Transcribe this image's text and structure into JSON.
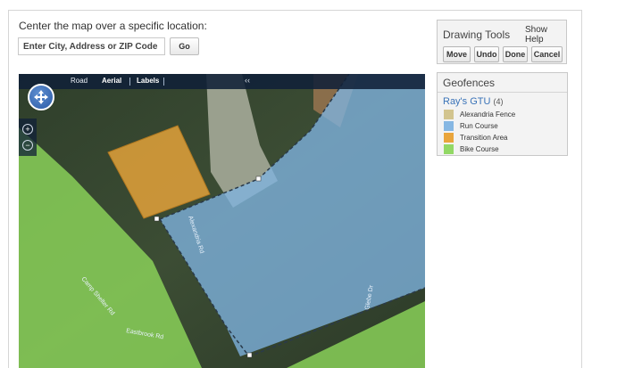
{
  "search": {
    "label": "Center the map over a specific location:",
    "placeholder": "Enter City, Address or ZIP Code",
    "go_label": "Go"
  },
  "map": {
    "tabs": [
      "Road",
      "Aerial",
      "Labels"
    ],
    "active_tabs": [
      "Aerial",
      "Labels"
    ],
    "collapse_glyph": "‹‹",
    "nav_icon": "compass-pan-icon",
    "zoom_in_icon": "zoom-in-icon",
    "zoom_out_icon": "zoom-out-icon",
    "road_labels": [
      "Alexandria Rd",
      "Glebe Dr",
      "Camp Shelter Rd",
      "Eastbrook Rd"
    ],
    "colors": {
      "fence": "#d9c48a",
      "run": "#7fb3e0",
      "transition": "#e9a53a",
      "bike": "#8cd65a"
    }
  },
  "drawing_tools": {
    "title": "Drawing Tools",
    "help_link": "Show Help",
    "buttons": [
      "Move",
      "Undo",
      "Done",
      "Cancel"
    ]
  },
  "geofences": {
    "title": "Geofences",
    "group_name": "Ray's GTU",
    "group_count": "(4)",
    "items": [
      {
        "label": "Alexandria Fence",
        "color": "#d2c48e"
      },
      {
        "label": "Run Course",
        "color": "#86b7e3"
      },
      {
        "label": "Transition Area",
        "color": "#e9a53c"
      },
      {
        "label": "Bike Course",
        "color": "#92d865"
      }
    ]
  }
}
